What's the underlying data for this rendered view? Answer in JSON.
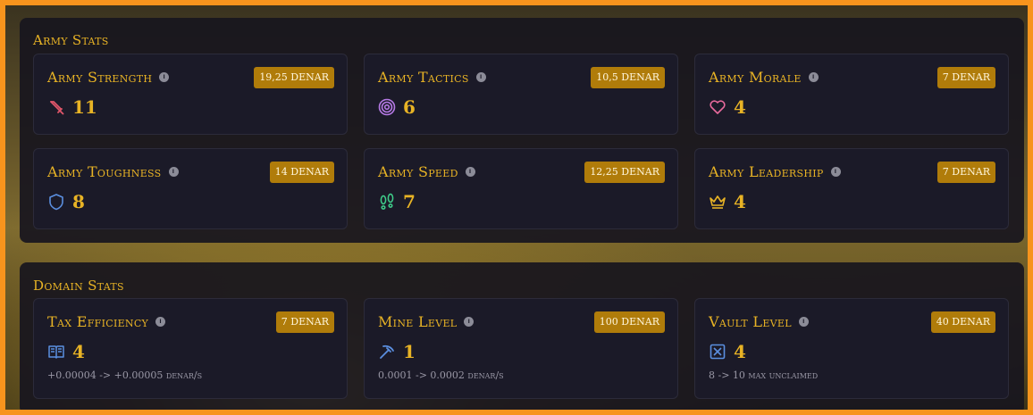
{
  "army": {
    "title": "Army Stats",
    "cards": [
      {
        "label": "Army Strength",
        "price": "19,25 DENAR",
        "value": "11",
        "icon": "sword-icon",
        "icon_color": "#e0566a"
      },
      {
        "label": "Army Tactics",
        "price": "10,5 DENAR",
        "value": "6",
        "icon": "target-icon",
        "icon_color": "#b67ae6"
      },
      {
        "label": "Army Morale",
        "price": "7 DENAR",
        "value": "4",
        "icon": "heart-icon",
        "icon_color": "#e86a9c"
      },
      {
        "label": "Army Toughness",
        "price": "14 DENAR",
        "value": "8",
        "icon": "shield-icon",
        "icon_color": "#5b8fe0"
      },
      {
        "label": "Army Speed",
        "price": "12,25 DENAR",
        "value": "7",
        "icon": "footprints-icon",
        "icon_color": "#3fcf8b"
      },
      {
        "label": "Army Leadership",
        "price": "7 DENAR",
        "value": "4",
        "icon": "crown-icon",
        "icon_color": "#e8b325"
      }
    ]
  },
  "domain": {
    "title": "Domain Stats",
    "cards": [
      {
        "label": "Tax Efficiency",
        "price": "7 DENAR",
        "value": "4",
        "icon": "book-open-icon",
        "icon_color": "#5b8fe0",
        "sub": "+0.00004 -> +0.00005 denar/s"
      },
      {
        "label": "Mine Level",
        "price": "100 DENAR",
        "value": "1",
        "icon": "pickaxe-icon",
        "icon_color": "#5b8fe0",
        "sub": "0.0001 -> 0.0002 denar/s"
      },
      {
        "label": "Vault Level",
        "price": "40 DENAR",
        "value": "4",
        "icon": "vault-icon",
        "icon_color": "#5b8fe0",
        "sub": "8 -> 10 max unclaimed"
      }
    ]
  }
}
